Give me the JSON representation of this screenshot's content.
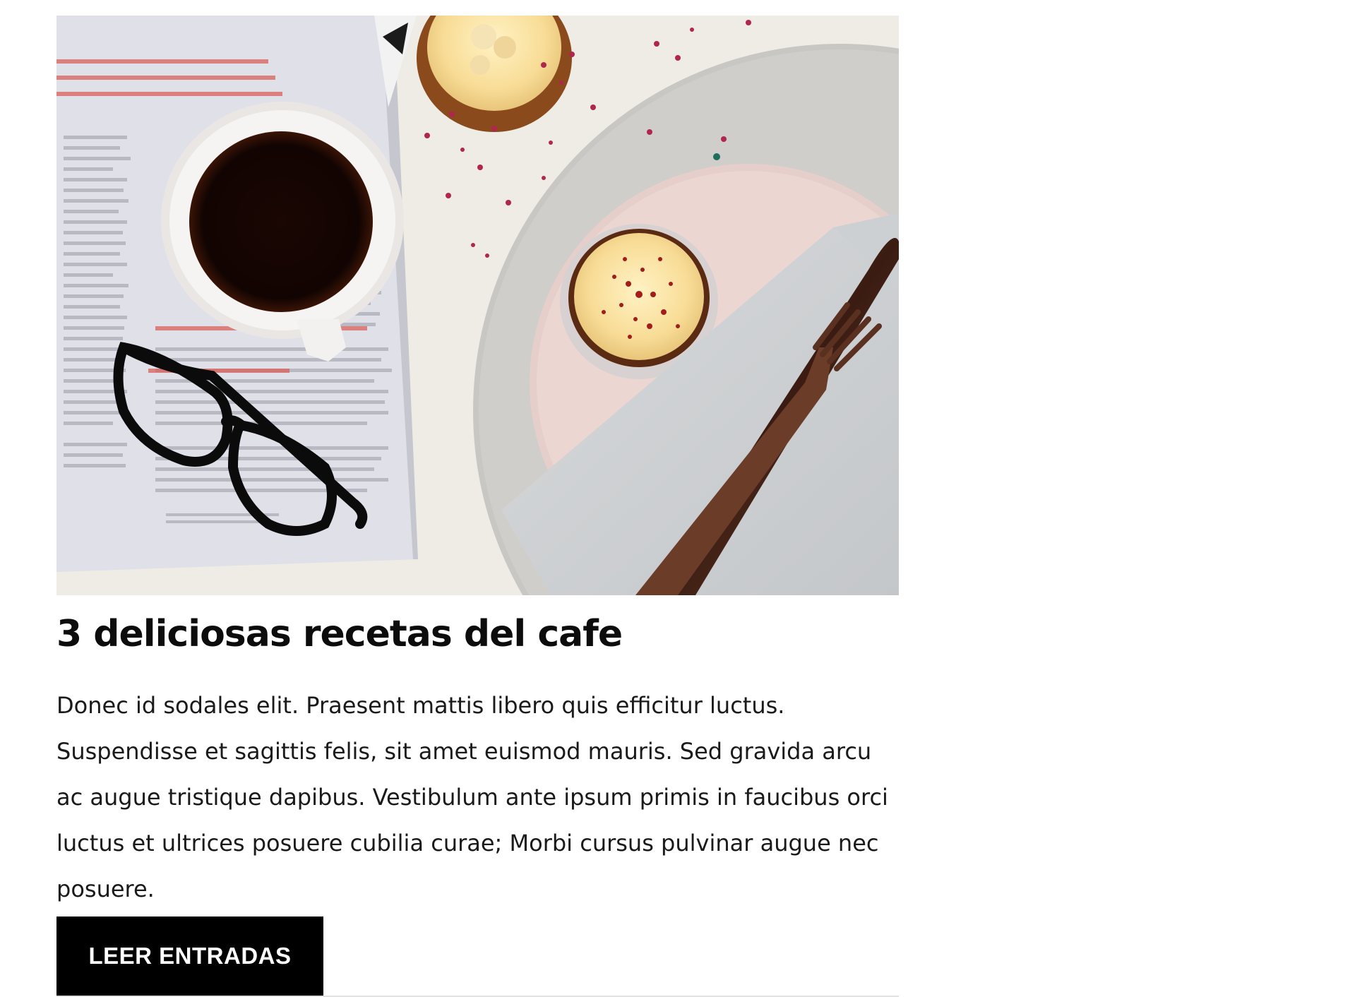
{
  "post": {
    "image_alt": "Coffee cup, glasses, magazine and cupcake on a plate",
    "title": "3 deliciosas recetas del cafe",
    "excerpt": "Donec id sodales elit. Praesent mattis libero quis efficitur luctus. Suspendisse et sagittis felis, sit amet euismod mauris. Sed gravida arcu ac augue tristique dapibus. Vestibulum ante ipsum primis in faucibus orci luctus et ultrices posuere cubilia curae; Morbi cursus pulvinar augue nec posuere.",
    "button_label": "LEER ENTRADAS"
  },
  "colors": {
    "button_bg": "#000000",
    "button_text": "#ffffff",
    "text": "#111111",
    "divider": "#e1e1e1"
  }
}
